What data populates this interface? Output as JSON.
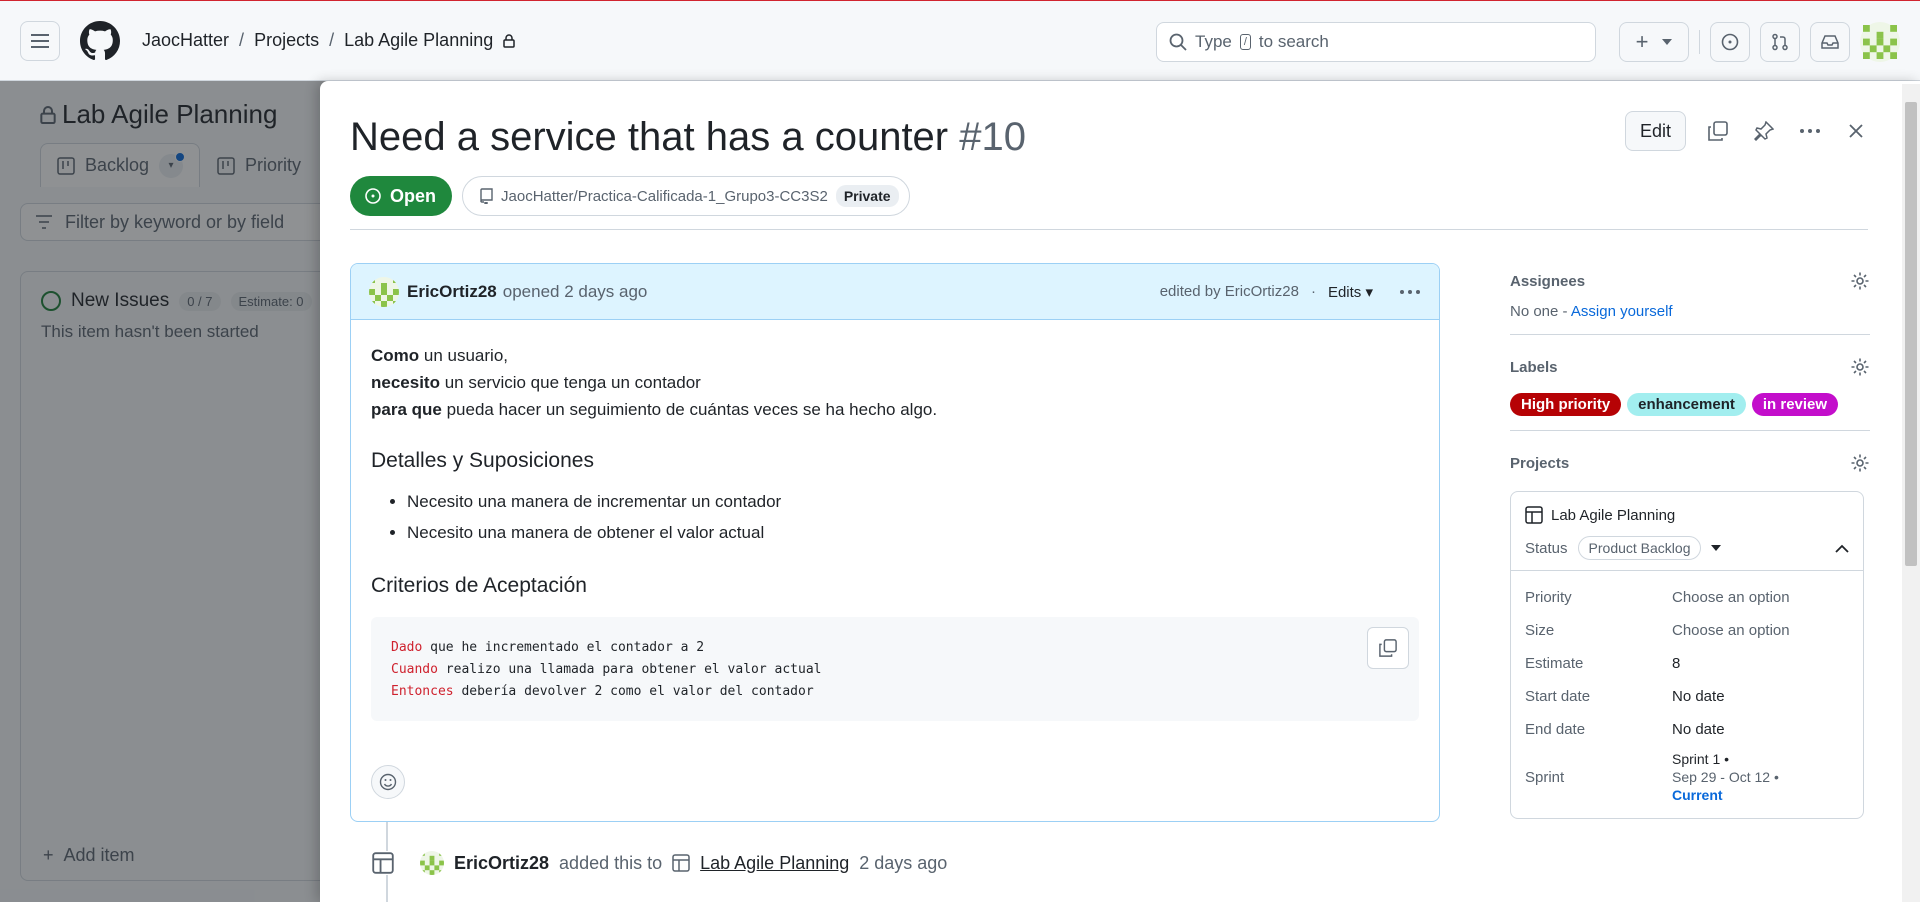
{
  "header": {
    "owner": "JaocHatter",
    "projects": "Projects",
    "project": "Lab Agile Planning",
    "search_prefix": "Type",
    "search_key": "/",
    "search_suffix": "to search"
  },
  "background": {
    "project_title": "Lab Agile Planning",
    "tabs": [
      {
        "label": "Backlog"
      },
      {
        "label": "Priority"
      }
    ],
    "filter_placeholder": "Filter by keyword or by field",
    "column": {
      "title": "New Issues",
      "count": "0 / 7",
      "estimate": "Estimate: 0",
      "subtitle": "This item hasn't been started",
      "add_item": "Add item"
    }
  },
  "issue": {
    "title": "Need a service that has a counter",
    "number": "#10",
    "edit_label": "Edit",
    "status": "Open",
    "repo": "JaocHatter/Practica-Calificada-1_Grupo3-CC3S2",
    "visibility": "Private",
    "author": "EricOrtiz28",
    "opened": "opened 2 days ago",
    "edited_by": "edited by EricOrtiz28",
    "edits_label": "Edits",
    "body": {
      "line1_bold": "Como",
      "line1_rest": " un usuario,",
      "line2_bold": "necesito",
      "line2_rest": " un servicio que tenga un contador",
      "line3_bold": "para que",
      "line3_rest": " pueda hacer un seguimiento de cuántas veces se ha hecho algo.",
      "h_details": "Detalles y Suposiciones",
      "bullets": [
        "Necesito una manera de incrementar un contador",
        "Necesito una manera de obtener el valor actual"
      ],
      "h_criteria": "Criterios de Aceptación",
      "code": [
        {
          "kw": "Dado",
          "rest": " que he incrementado el contador a 2"
        },
        {
          "kw": "Cuando",
          "rest": " realizo una llamada para obtener el valor actual"
        },
        {
          "kw": "Entonces",
          "rest": " debería devolver 2 como el valor del contador"
        }
      ]
    },
    "timeline": {
      "author": "EricOrtiz28",
      "action": "added this to",
      "project": "Lab Agile Planning",
      "time": "2 days ago"
    }
  },
  "sidebar": {
    "assignees_title": "Assignees",
    "assignees_none": "No one",
    "assignees_sep": " - ",
    "assign_yourself": "Assign yourself",
    "labels_title": "Labels",
    "labels": [
      {
        "name": "High priority",
        "bg": "#b60205",
        "fg": "#ffffff"
      },
      {
        "name": "enhancement",
        "bg": "#a2eeef",
        "fg": "#1f2328"
      },
      {
        "name": "in review",
        "bg": "#c30ecb",
        "fg": "#ffffff"
      }
    ],
    "projects_title": "Projects",
    "project_name": "Lab Agile Planning",
    "status_label": "Status",
    "status_value": "Product Backlog",
    "fields": {
      "priority_k": "Priority",
      "priority_v": "Choose an option",
      "size_k": "Size",
      "size_v": "Choose an option",
      "estimate_k": "Estimate",
      "estimate_v": "8",
      "start_k": "Start date",
      "start_v": "No date",
      "end_k": "End date",
      "end_v": "No date",
      "sprint_k": "Sprint",
      "sprint_l1": "Sprint 1 •",
      "sprint_l2": "Sep 29 - Oct 12 •",
      "sprint_current": "Current"
    }
  },
  "colors": {
    "open_green": "#1f883d",
    "link_blue": "#0969da",
    "card_header": "#ddf4ff"
  }
}
